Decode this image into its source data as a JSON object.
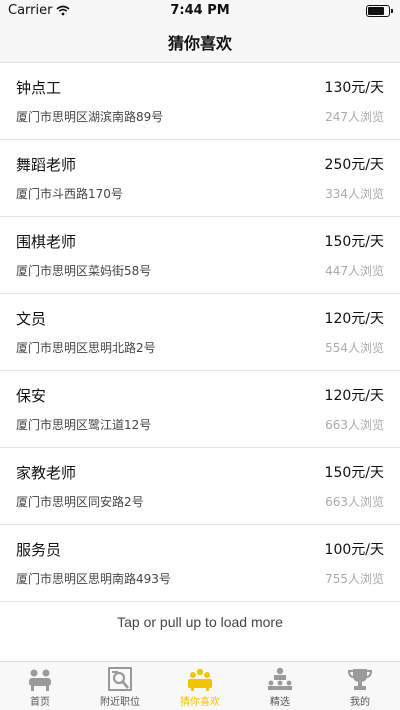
{
  "status": {
    "carrier": "Carrier",
    "time": "7:44 PM",
    "battery_level": 0.9
  },
  "nav": {
    "title": "猜你喜欢"
  },
  "jobs": [
    {
      "title": "钟点工",
      "salary": "130元/天",
      "address": "厦门市思明区湖滨南路89号",
      "views": "247人浏览"
    },
    {
      "title": "舞蹈老师",
      "salary": "250元/天",
      "address": "厦门市斗西路170号",
      "views": "334人浏览"
    },
    {
      "title": "围棋老师",
      "salary": "150元/天",
      "address": "厦门市思明区菜妈街58号",
      "views": "447人浏览"
    },
    {
      "title": "文员",
      "salary": "120元/天",
      "address": "厦门市思明区思明北路2号",
      "views": "554人浏览"
    },
    {
      "title": "保安",
      "salary": "120元/天",
      "address": "厦门市思明区鹭江道12号",
      "views": "663人浏览"
    },
    {
      "title": "家教老师",
      "salary": "150元/天",
      "address": "厦门市思明区同安路2号",
      "views": "663人浏览"
    },
    {
      "title": "服务员",
      "salary": "100元/天",
      "address": "厦门市思明区思明南路493号",
      "views": "755人浏览"
    }
  ],
  "load_more": "Tap or pull up to load more",
  "tabs": [
    {
      "label": "首页",
      "icon": "home-people-icon",
      "active": false
    },
    {
      "label": "附近职位",
      "icon": "nearby-jobs-icon",
      "active": false
    },
    {
      "label": "猜你喜欢",
      "icon": "guess-like-icon",
      "active": true
    },
    {
      "label": "精选",
      "icon": "featured-icon",
      "active": false
    },
    {
      "label": "我的",
      "icon": "profile-trophy-icon",
      "active": false
    }
  ],
  "colors": {
    "accent": "#f0c400",
    "inactive": "#9a9a9a",
    "bar": "#f7f7f7"
  }
}
